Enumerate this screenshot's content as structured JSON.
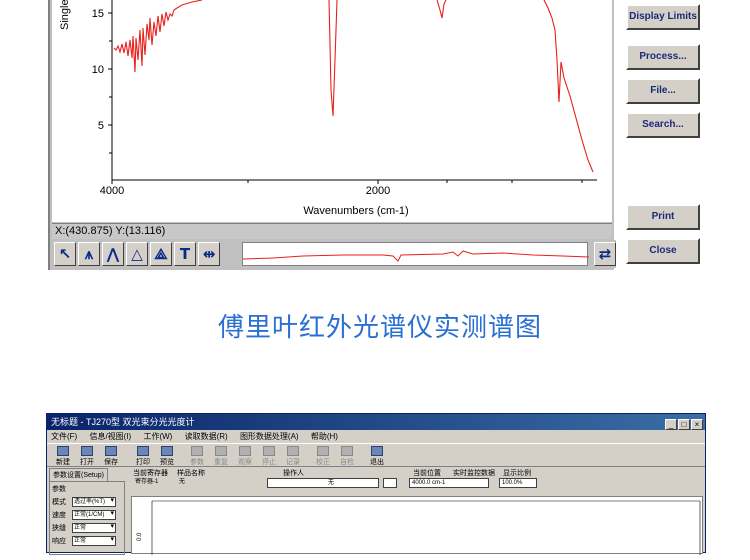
{
  "ftir": {
    "y_axis_label": "Single",
    "y_ticks": [
      "15",
      "10",
      "5"
    ],
    "x_ticks": [
      "4000",
      "2000"
    ],
    "x_axis_label": "Wavenumbers (cm-1)",
    "coordinate_readout": "X:(430.875) Y:(13.116)",
    "trace_color": "#e8201a",
    "tools": [
      "select-arrow",
      "peak-region",
      "peak-pick",
      "baseline",
      "peak-area",
      "text-annotate",
      "expand-arrows"
    ]
  },
  "side_buttons": {
    "display_limits": "Display Limits",
    "process": "Process...",
    "file": "File...",
    "search": "Search...",
    "print": "Print",
    "close": "Close"
  },
  "caption": "傅里叶红外光谱仪实测谱图",
  "app": {
    "title": "无标题 - TJ270型 双光束分光光度计",
    "menu": [
      "文件(F)",
      "信息/视图(I)",
      "工作(W)",
      "读取数据(R)",
      "图形数据处理(A)",
      "帮助(H)"
    ],
    "toolbar": [
      "新建",
      "打开",
      "保存",
      "打印",
      "预览",
      "参数",
      "重复",
      "观察",
      "停止",
      "记录",
      "校正",
      "自检",
      "退出"
    ],
    "left_tab": "参数设置(Setup)",
    "param_group": "参数",
    "params": [
      {
        "label": "模式",
        "value": "透过率(%T)"
      },
      {
        "label": "速度",
        "value": "正常(1/CM)"
      },
      {
        "label": "狭缝",
        "value": "正常"
      },
      {
        "label": "响应",
        "value": "正常"
      }
    ],
    "info_labels": {
      "register": "当前寄存器",
      "sample": "样品名称",
      "operator": "操作人",
      "position": "当前位置",
      "realtime": "实时监控数据",
      "ratio": "显示比例"
    },
    "info_values": {
      "register": "寄存器-1",
      "sample": "无",
      "operator": "无",
      "position": "4000.0 cm-1",
      "ratio": "100.0%"
    },
    "graph_y_tick": "0.0"
  }
}
